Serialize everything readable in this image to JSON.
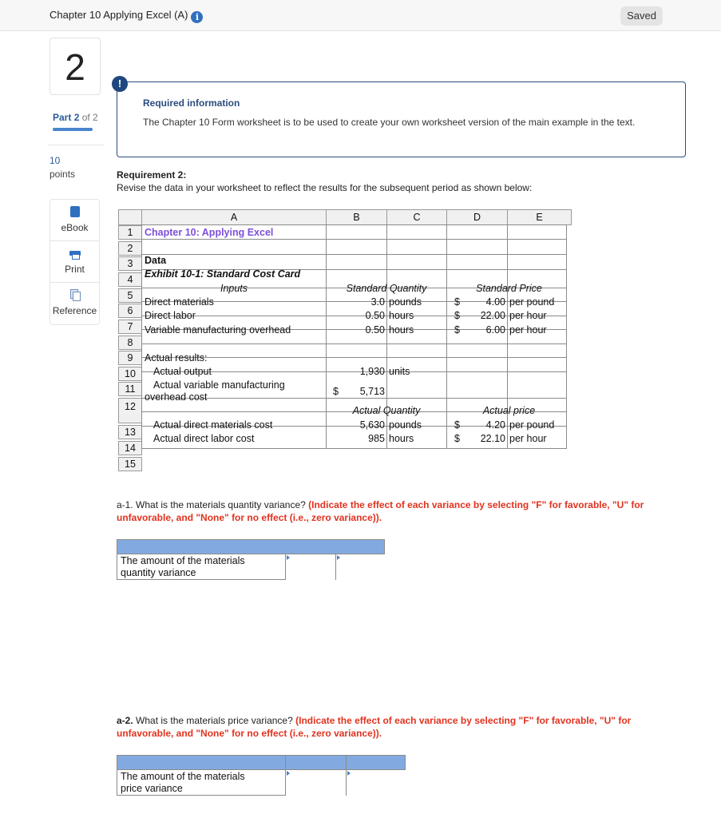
{
  "header": {
    "title": "Chapter 10 Applying Excel (A)",
    "info_icon": "info-icon",
    "status": "Saved"
  },
  "sidebar": {
    "question_number": "2",
    "part_label": "Part",
    "part_current": "2",
    "part_of": "of 2",
    "part_progress": 1.0,
    "points_value": "10",
    "points_label": "points",
    "tools": [
      {
        "icon": "book-icon",
        "label": "eBook"
      },
      {
        "icon": "print-icon",
        "label": "Print"
      },
      {
        "icon": "reference-icon",
        "label": "Reference"
      }
    ]
  },
  "required_info": {
    "badge": "!",
    "heading": "Required information",
    "text": "The Chapter 10 Form worksheet is to be used to create your own worksheet version of the main example in the text."
  },
  "requirement": {
    "heading": "Requirement 2:",
    "text": "Revise the data in your worksheet to reflect the results for the subsequent period as shown below:"
  },
  "spreadsheet": {
    "columns": [
      "A",
      "B",
      "C",
      "D",
      "E"
    ],
    "row_numbers": [
      "1",
      "2",
      "3",
      "4",
      "5",
      "6",
      "7",
      "8",
      "9",
      "10",
      "11",
      "12",
      "13",
      "14",
      "15"
    ],
    "title": "Chapter 10: Applying Excel",
    "data_label": "Data",
    "exhibit": "Exhibit 10-1: Standard Cost Card",
    "inputs_header": "Inputs",
    "std_qty_header": "Standard Quantity",
    "std_price_header": "Standard Price",
    "standard_rows": [
      {
        "label": "Direct materials",
        "qty": "3.0",
        "qty_unit": "pounds",
        "cur": "$",
        "price": "4.00",
        "price_unit": "per pound"
      },
      {
        "label": "Direct labor",
        "qty": "0.50",
        "qty_unit": "hours",
        "cur": "$",
        "price": "22.00",
        "price_unit": "per hour"
      },
      {
        "label": "Variable manufacturing overhead",
        "qty": "0.50",
        "qty_unit": "hours",
        "cur": "$",
        "price": "6.00",
        "price_unit": "per hour"
      }
    ],
    "actual_results_label": "Actual results:",
    "actual_output_label": "Actual output",
    "actual_output_value": "1,930",
    "actual_output_unit": "units",
    "actual_vmoh_label_1": "Actual variable manufacturing",
    "actual_vmoh_label_2": "overhead cost",
    "actual_vmoh_cur": "$",
    "actual_vmoh_value": "5,713",
    "actual_qty_header": "Actual Quantity",
    "actual_price_header": "Actual price",
    "actual_rows": [
      {
        "label": "Actual direct materials cost",
        "qty": "5,630",
        "qty_unit": "pounds",
        "cur": "$",
        "price": "4.20",
        "price_unit": "per pound"
      },
      {
        "label": "Actual direct labor cost",
        "qty": "985",
        "qty_unit": "hours",
        "cur": "$",
        "price": "22.10",
        "price_unit": "per hour"
      }
    ]
  },
  "questions": [
    {
      "id": "a-1.",
      "text": "What is the materials quantity variance?",
      "instruction": "(Indicate the effect of each variance by selecting \"F\" for favorable, \"U\" for unfavorable, and \"None\" for no effect (i.e., zero variance)).",
      "row_label_1": "The amount of the materials",
      "row_label_2": "quantity variance",
      "amount_value": "",
      "effect_value": ""
    },
    {
      "id": "a-2.",
      "text": "What is the materials price variance?",
      "instruction": "(Indicate the effect of each variance by selecting \"F\" for favorable, \"U\" for unfavorable, and \"None\" for no effect (i.e., zero variance)).",
      "row_label_1": "The amount of the materials",
      "row_label_2": "price variance",
      "amount_value": "",
      "effect_value": ""
    }
  ]
}
